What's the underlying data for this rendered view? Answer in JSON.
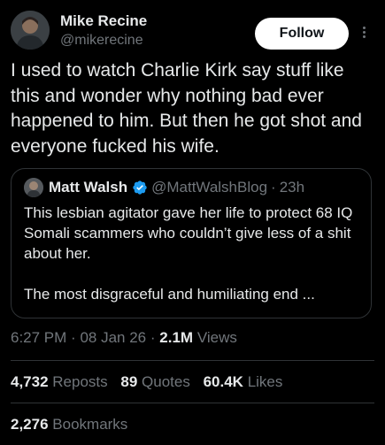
{
  "author": {
    "display_name": "Mike Recine",
    "handle": "@mikerecine"
  },
  "follow_label": "Follow",
  "tweet_text": "I used to watch Charlie Kirk say stuff like this and wonder why nothing bad ever happened to him. But then he got shot and everyone fucked his wife.",
  "quote": {
    "display_name": "Matt Walsh",
    "handle": "@MattWalshBlog",
    "dot": "·",
    "time": "23h",
    "verified_color": "#1d9bf0",
    "line1": "This lesbian agitator gave her life to protect 68 IQ Somali scammers who couldn’t give less of a shit about her.",
    "line2": "The most disgraceful and humiliating end ..."
  },
  "meta": {
    "time": "6:27 PM",
    "sep1": "·",
    "date": "08 Jan 26",
    "sep2": "·",
    "views_count": "2.1M",
    "views_label": "Views"
  },
  "stats": {
    "reposts_count": "4,732",
    "reposts_label": "Reposts",
    "quotes_count": "89",
    "quotes_label": "Quotes",
    "likes_count": "60.4K",
    "likes_label": "Likes",
    "bookmarks_count": "2,276",
    "bookmarks_label": "Bookmarks"
  }
}
